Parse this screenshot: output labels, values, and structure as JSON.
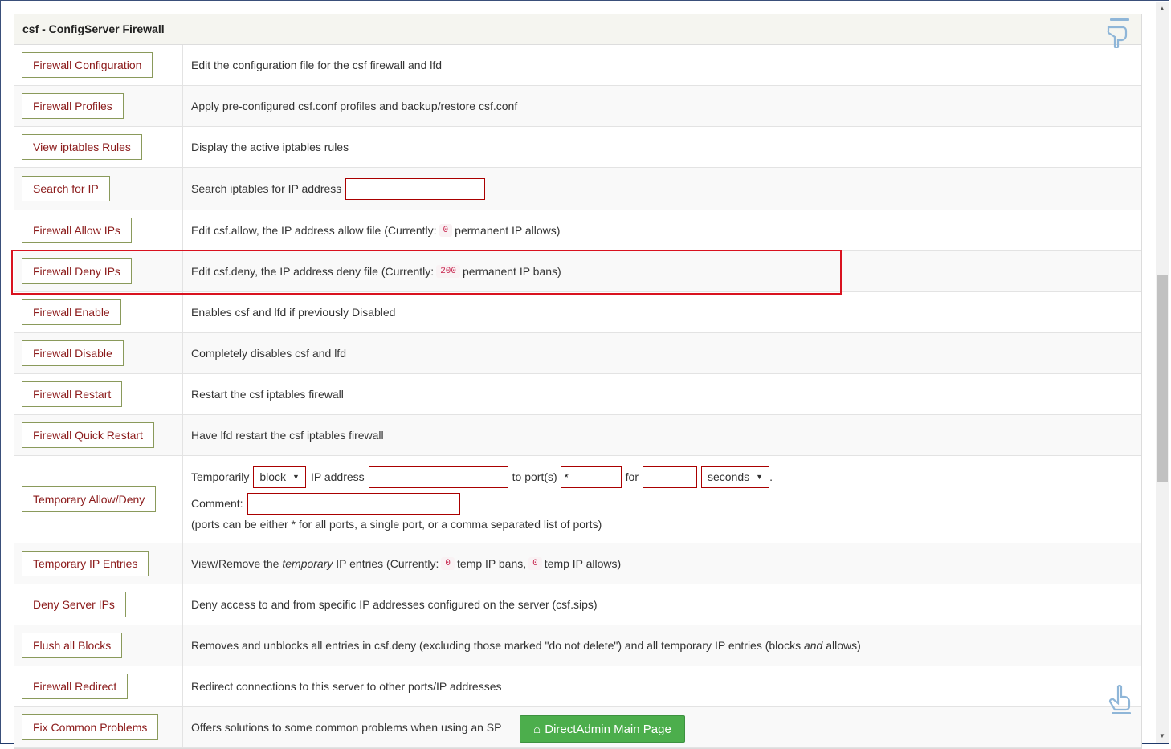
{
  "panel": {
    "title": "csf - ConfigServer Firewall"
  },
  "rows": [
    {
      "button": "Firewall Configuration",
      "desc": "Edit the configuration file for the csf firewall and lfd"
    },
    {
      "button": "Firewall Profiles",
      "desc": "Apply pre-configured csf.conf profiles and backup/restore csf.conf"
    },
    {
      "button": "View iptables Rules",
      "desc": "Display the active iptables rules"
    },
    {
      "button": "Search for IP",
      "desc": "Search iptables for IP address"
    },
    {
      "button": "Firewall Allow IPs",
      "desc_pre": "Edit csf.allow, the IP address allow file (Currently:",
      "count": "0",
      "desc_post": "permanent IP allows)"
    },
    {
      "button": "Firewall Deny IPs",
      "desc_pre": "Edit csf.deny, the IP address deny file (Currently:",
      "count": "200",
      "desc_post": "permanent IP bans)"
    },
    {
      "button": "Firewall Enable",
      "desc": "Enables csf and lfd if previously Disabled"
    },
    {
      "button": "Firewall Disable",
      "desc": "Completely disables csf and lfd"
    },
    {
      "button": "Firewall Restart",
      "desc": "Restart the csf iptables firewall"
    },
    {
      "button": "Firewall Quick Restart",
      "desc": "Have lfd restart the csf iptables firewall"
    },
    {
      "button": "Temporary Allow/Deny"
    },
    {
      "button": "Temporary IP Entries",
      "desc_pre": "View/Remove the",
      "desc_em": "temporary",
      "desc_mid": "IP entries (Currently:",
      "count1": "0",
      "desc_mid2": "temp IP bans,",
      "count2": "0",
      "desc_post": "temp IP allows)"
    },
    {
      "button": "Deny Server IPs",
      "desc": "Deny access to and from specific IP addresses configured on the server (csf.sips)"
    },
    {
      "button": "Flush all Blocks",
      "desc_pre": "Removes and unblocks all entries in csf.deny (excluding those marked \"do not delete\") and all temporary IP entries (blocks",
      "desc_em": "and",
      "desc_post": "allows)"
    },
    {
      "button": "Firewall Redirect",
      "desc": "Redirect connections to this server to other ports/IP addresses"
    },
    {
      "button": "Fix Common Problems",
      "desc": "Offers solutions to some common problems when using an SP"
    }
  ],
  "temp": {
    "label_temporarily": "Temporarily",
    "action_selected": "block",
    "label_ip": "IP address",
    "label_ports": "to port(s)",
    "ports_value": "*",
    "label_for": "for",
    "unit_selected": "seconds",
    "period": ".",
    "label_comment": "Comment:",
    "note": "(ports can be either * for all ports, a single port, or a comma separated list of ports)"
  },
  "main_button": "DirectAdmin Main Page"
}
